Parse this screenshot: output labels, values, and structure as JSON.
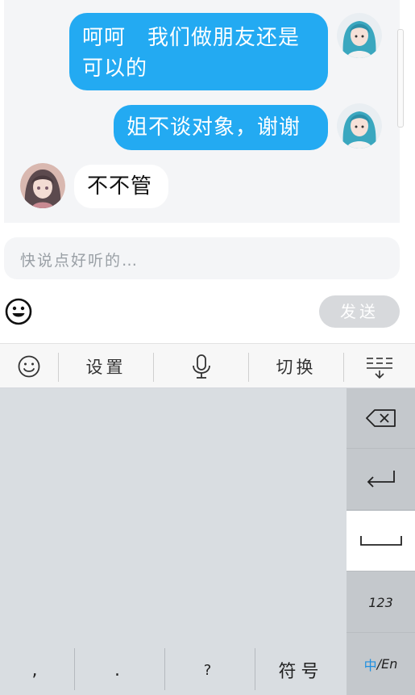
{
  "chat": {
    "messages": [
      {
        "side": "right",
        "lines": [
          "呵呵　我们做朋友还是",
          "可以的"
        ]
      },
      {
        "side": "right",
        "lines": [
          "姐不谈对象，谢谢"
        ]
      },
      {
        "side": "left",
        "lines": [
          "不不管"
        ]
      }
    ]
  },
  "input": {
    "placeholder": "快说点好听的…"
  },
  "send_label": "发送",
  "toolbar": {
    "settings_label": "设置",
    "switch_label": "切换"
  },
  "keyboard": {
    "num_label": "123",
    "lang_label_cn": "中",
    "lang_label_en": "/En",
    "keys": {
      "comma": ",",
      "period": ".",
      "question": "?",
      "symbols": "符号"
    }
  },
  "colors": {
    "bubble_blue": "#23aaf2",
    "send_disabled": "#d7d9dc",
    "keyboard_bg": "#d9dde1"
  }
}
